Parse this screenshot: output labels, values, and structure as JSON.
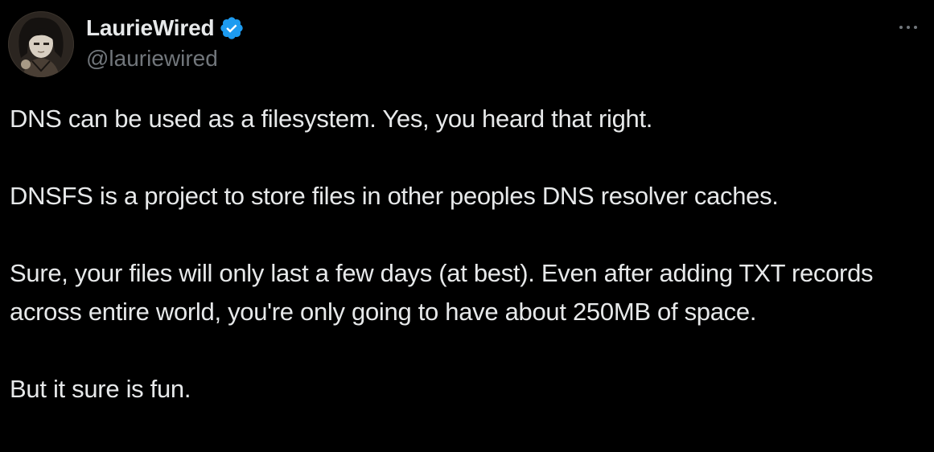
{
  "author": {
    "display_name": "LaurieWired",
    "handle": "@lauriewired",
    "verified": true
  },
  "icons": {
    "avatar": "avatar-illustration",
    "verified": "verified-badge-icon",
    "more": "more-options-icon"
  },
  "colors": {
    "background": "#000000",
    "text": "#e7e9ea",
    "secondary_text": "#71767b",
    "verified_blue": "#1d9bf0"
  },
  "tweet": {
    "paragraphs": [
      "DNS can be used as a filesystem.  Yes, you heard that right.",
      "DNSFS is a project to store files in other peoples DNS resolver caches.",
      "Sure, your files will only last a few days (at best).  Even after adding TXT records across entire world, you're only going to have about 250MB of space.",
      "But it sure is fun."
    ]
  }
}
